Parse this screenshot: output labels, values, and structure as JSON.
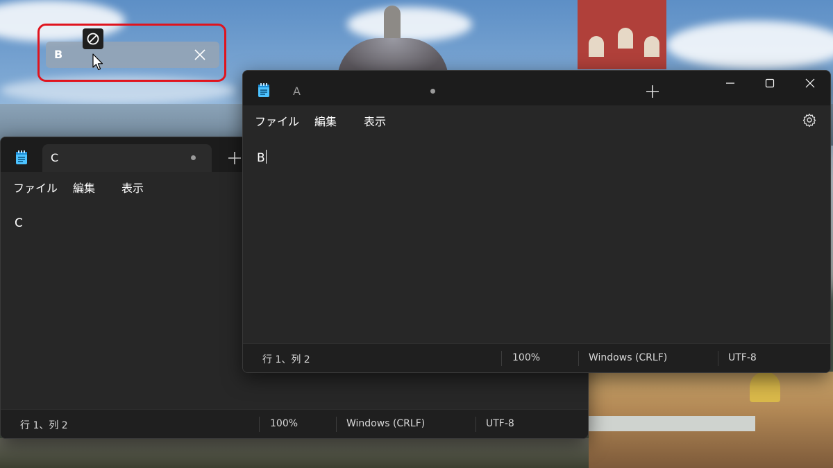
{
  "drag_ghost": {
    "tab_label": "B",
    "drop_state_icon": "no-drop-icon",
    "highlight_color": "#e0141e"
  },
  "back_window": {
    "tab": {
      "label": "C",
      "modified_indicator": true
    },
    "menu": [
      "ファイル",
      "編集",
      "表示"
    ],
    "content": "C",
    "status": {
      "position": "行 1、列 2",
      "zoom": "100%",
      "line_ending": "Windows (CRLF)",
      "encoding": "UTF-8"
    }
  },
  "front_window": {
    "tab": {
      "label": "A",
      "modified_indicator": true
    },
    "menu": [
      "ファイル",
      "編集",
      "表示"
    ],
    "content": "B",
    "status": {
      "position": "行 1、列 2",
      "zoom": "100%",
      "line_ending": "Windows (CRLF)",
      "encoding": "UTF-8"
    }
  },
  "colors": {
    "window_bg": "#202020",
    "titlebar_bg": "#1c1c1c",
    "menubar_bg": "#272727",
    "text": "#ffffff",
    "app_icon": "#4cc2ff"
  }
}
